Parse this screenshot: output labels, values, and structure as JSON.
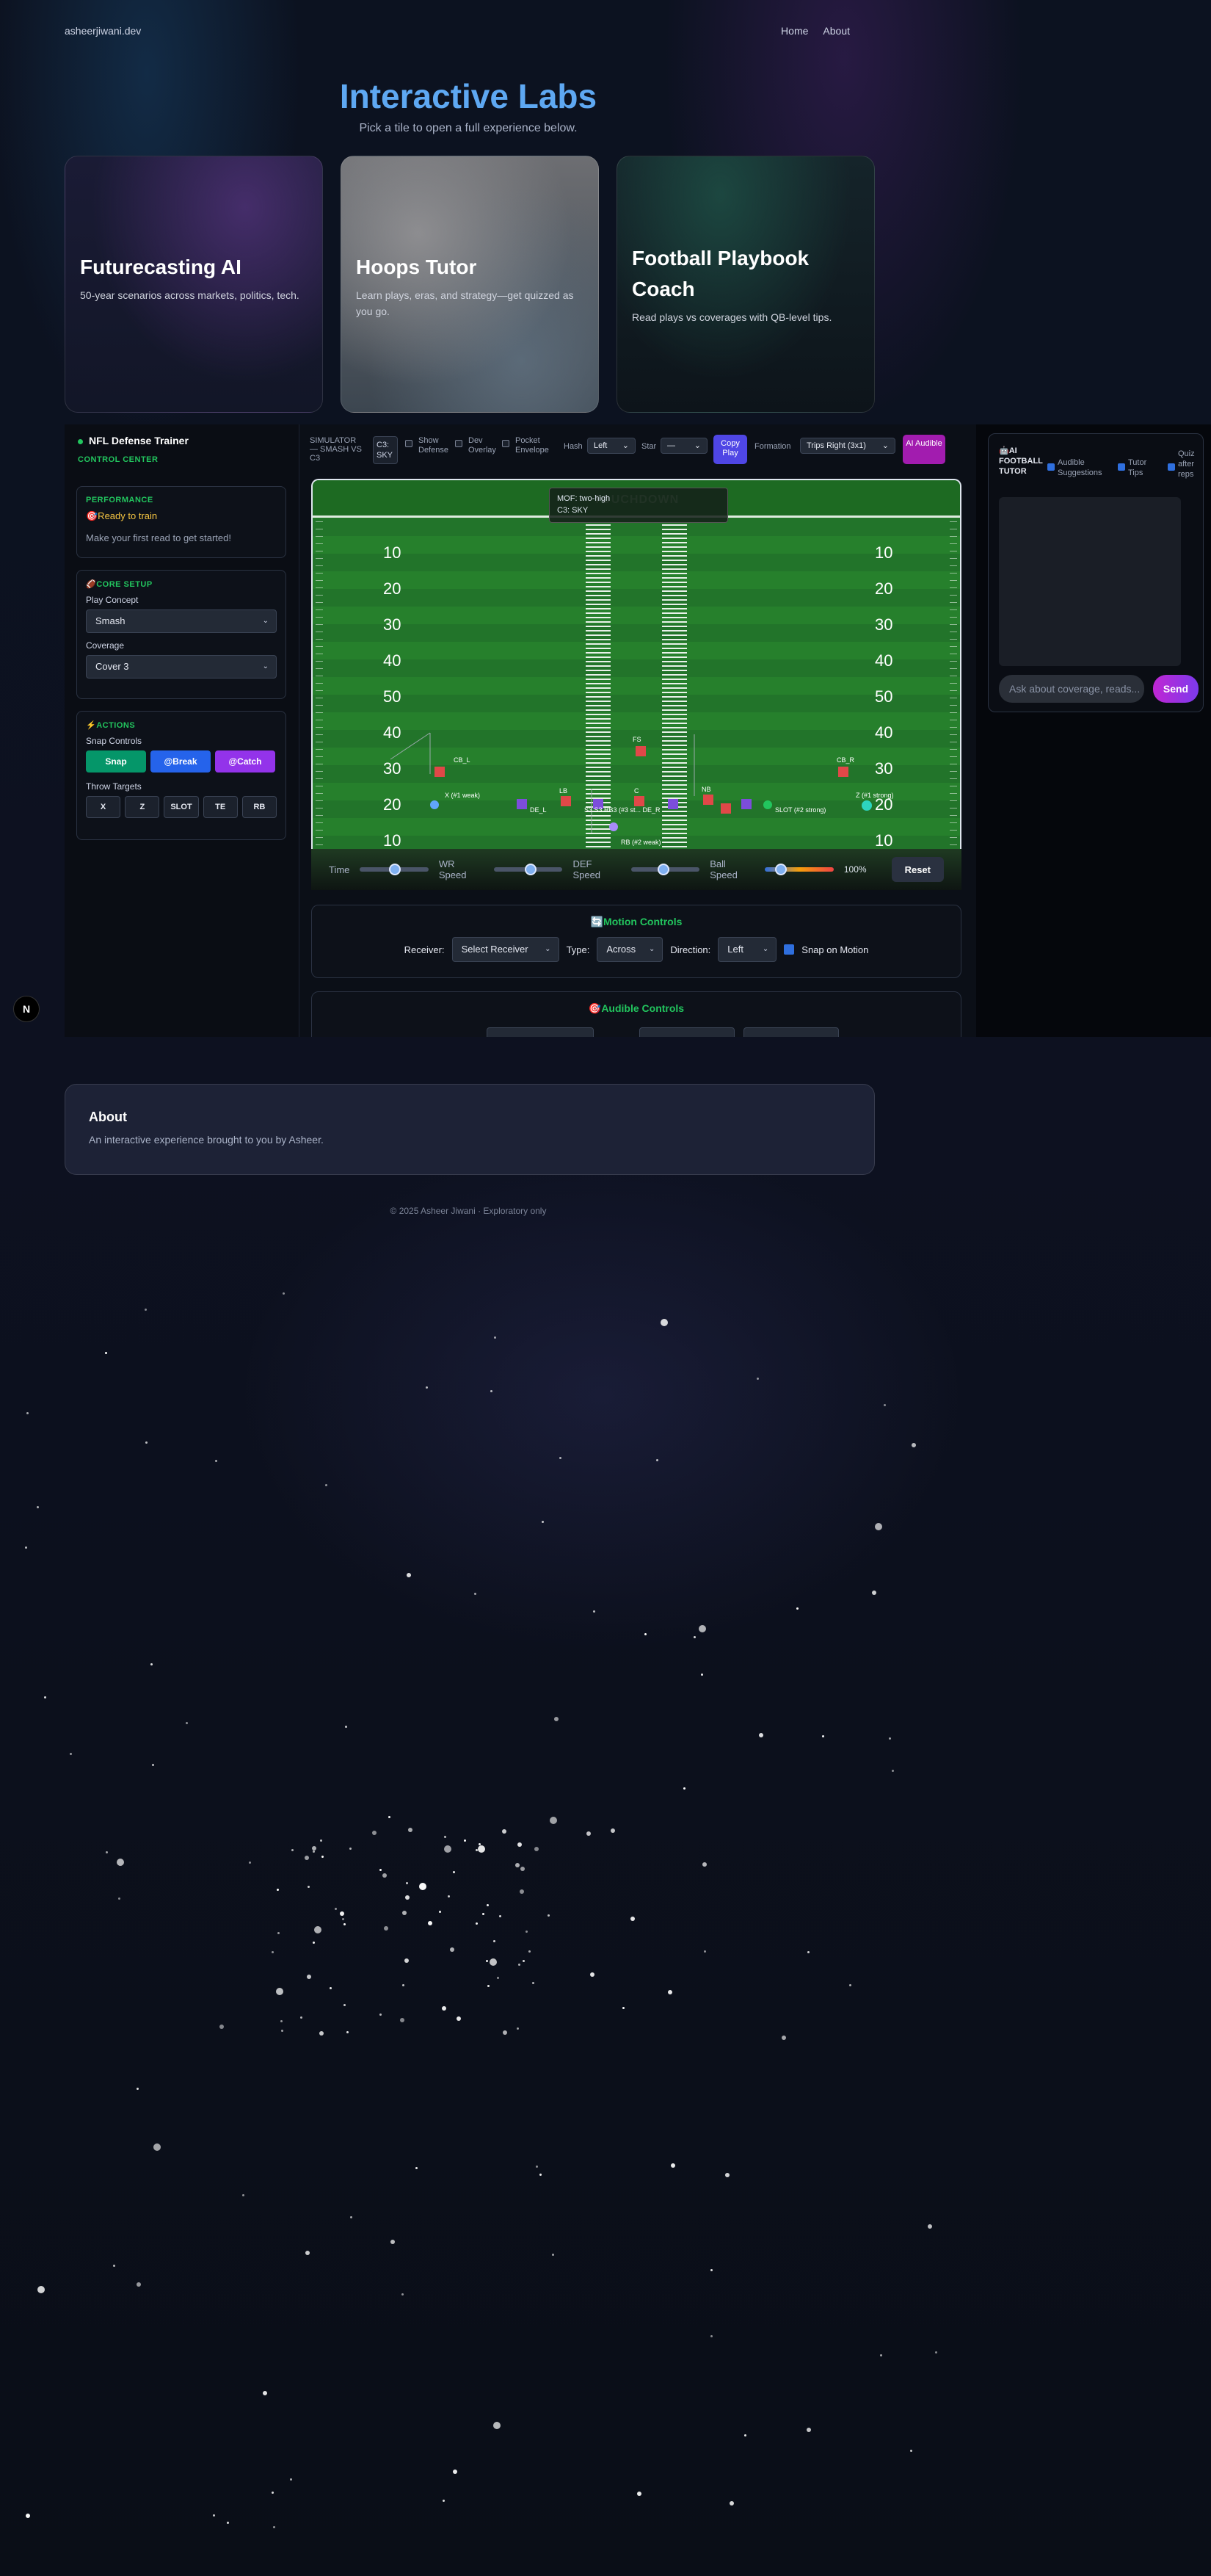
{
  "nav": {
    "brand": "asheerjiwani.dev",
    "links": [
      "Home",
      "About"
    ]
  },
  "hero": {
    "title": "Interactive Labs",
    "subtitle": "Pick a tile to open a full experience below."
  },
  "tiles": [
    {
      "title": "Futurecasting AI",
      "desc": "50-year scenarios across markets, politics, tech."
    },
    {
      "title": "Hoops Tutor",
      "desc": "Learn plays, eras, and strategy—get quizzed as you go."
    },
    {
      "title": "Football Playbook Coach",
      "desc": "Read plays vs coverages with QB-level tips."
    }
  ],
  "sidebar": {
    "title": "NFL Defense Trainer",
    "subtitle": "CONTROL CENTER",
    "performance": {
      "heading": "PERFORMANCE",
      "status": "🎯Ready to train",
      "hint": "Make your first read to get started!"
    },
    "core": {
      "heading": "🏈CORE SETUP",
      "play_label": "Play Concept",
      "play_value": "Smash",
      "coverage_label": "Coverage",
      "coverage_value": "Cover 3"
    },
    "actions": {
      "heading": "⚡ACTIONS",
      "snap_label": "Snap Controls",
      "snap_buttons": [
        "Snap",
        "@Break",
        "@Catch"
      ],
      "throw_label": "Throw Targets",
      "throw_buttons": [
        "X",
        "Z",
        "SLOT",
        "TE",
        "RB"
      ]
    }
  },
  "badge": "N",
  "toolbar": {
    "sim_label": "SIMULATOR — SMASH VS C3",
    "sky_chip": "C3: SKY",
    "show_defense": "Show Defense",
    "dev_overlay": "Dev Overlay",
    "pocket_envelope": "Pocket Envelope",
    "hash_label": "Hash",
    "hash_value": "Left",
    "star_label": "Star",
    "star_value": "—",
    "copy_play": "Copy Play",
    "formation_label": "Formation",
    "formation_value": "Trips Right (3x1)",
    "ai_audible": "AI Audible"
  },
  "field": {
    "endzone": "TOUCHDOWN",
    "overlay": [
      "MOF: two-high",
      "C3: SKY"
    ],
    "left_numbers": [
      "10",
      "20",
      "30",
      "40",
      "50",
      "40",
      "30",
      "20",
      "10"
    ],
    "right_numbers": [
      "10",
      "20",
      "30",
      "40",
      "50",
      "40",
      "30",
      "20",
      "10"
    ],
    "players": {
      "fs": "FS",
      "cb_l": "CB_L",
      "cb_r": "CB_R",
      "lb": "LB",
      "c": "C",
      "nb": "NB",
      "x": "X (#1 weak)",
      "z": "Z (#1 strong)",
      "rb": "RB (#2 weak)",
      "de_l": "DE_L",
      "slot": "SLOT (#2 strong)",
      "mix": "S3 S3 RB3 (#3 st... DE_R"
    }
  },
  "sliders": {
    "time": "Time",
    "wr": "WR Speed",
    "def": "DEF Speed",
    "ball": "Ball Speed",
    "ball_pct": "100%",
    "reset": "Reset"
  },
  "motion": {
    "heading": "🔄Motion Controls",
    "receiver_label": "Receiver:",
    "receiver_value": "Select Receiver",
    "type_label": "Type:",
    "type_value": "Across",
    "direction_label": "Direction:",
    "direction_value": "Left",
    "snap_on_motion": "Snap on Motion"
  },
  "audible": {
    "heading": "🎯Audible Controls"
  },
  "tutor": {
    "title": "🤖AI FOOTBALL TUTOR",
    "audible_suggestions": "Audible Suggestions",
    "tutor_tips": "Tutor Tips",
    "quiz": "Quiz after reps",
    "placeholder": "Ask about coverage, reads...",
    "send": "Send"
  },
  "about": {
    "title": "About",
    "text": "An interactive experience brought to you by Asheer."
  },
  "footer": "© 2025 Asheer Jiwani · Exploratory only",
  "colors": {
    "accent_blue": "#5ea8f2",
    "green": "#22c55e",
    "field": "#247a2a",
    "defense": "#e04848",
    "offense": "#7c4ddb",
    "purple_btn": "#9333ea"
  }
}
